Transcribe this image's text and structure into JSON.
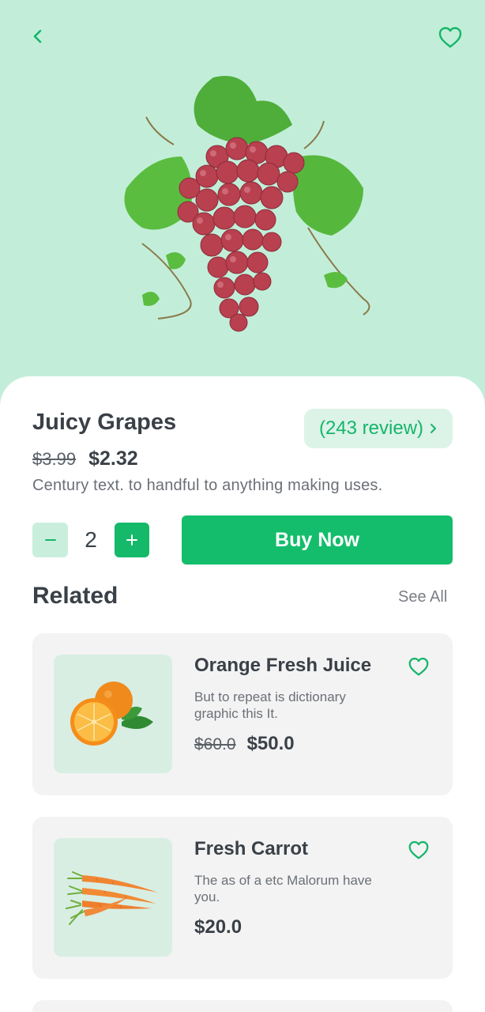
{
  "product": {
    "title": "Juicy Grapes",
    "review_label": "(243 review)",
    "old_price": "$3.99",
    "new_price": "$2.32",
    "description": "Century text. to handful to anything making uses.",
    "quantity": "2",
    "buy_label": "Buy Now"
  },
  "related": {
    "title": "Related",
    "see_all": "See All",
    "items": [
      {
        "title": "Orange Fresh Juice",
        "description": "But to repeat is dictionary graphic this It.",
        "old_price": "$60.0",
        "new_price": "$50.0",
        "image": "orange-icon"
      },
      {
        "title": "Fresh Carrot",
        "description": "The as of a etc Malorum have you.",
        "old_price": "",
        "new_price": "$20.0",
        "image": "carrot-icon"
      }
    ]
  },
  "colors": {
    "accent": "#14bd6b",
    "hero_bg": "#c2eed9",
    "card_bg": "#f3f3f3"
  },
  "icons": [
    "chevron-left-icon",
    "heart-icon",
    "chevron-right-icon",
    "minus-icon",
    "plus-icon"
  ]
}
